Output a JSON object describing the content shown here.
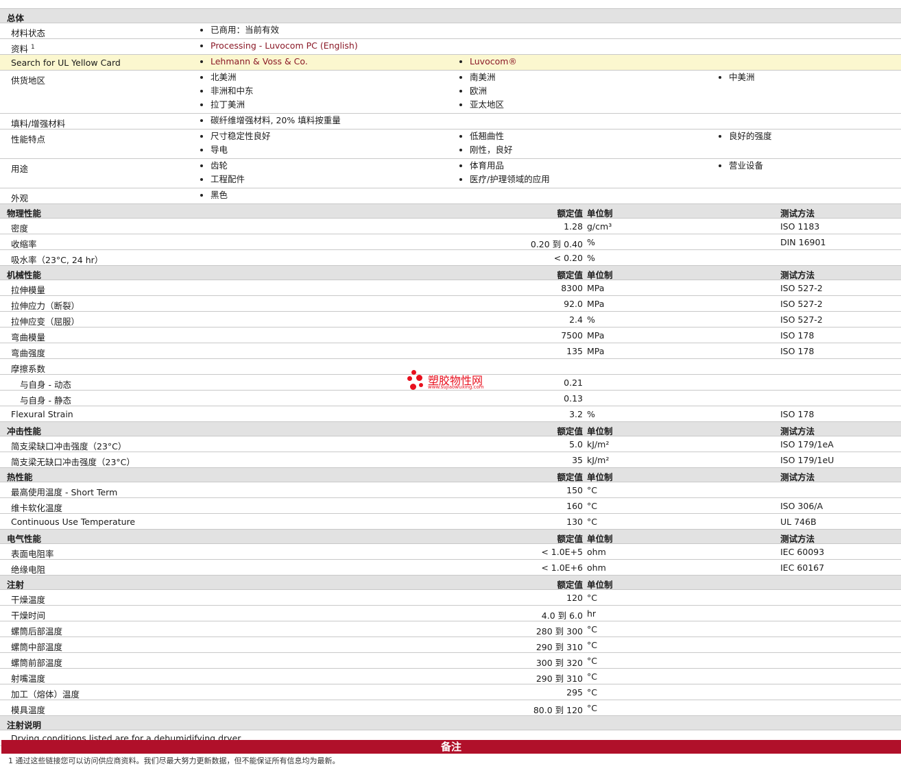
{
  "general": {
    "section_title": "总体",
    "rows": {
      "material_status": {
        "label": "材料状态",
        "value": "已商用：当前有效"
      },
      "literature": {
        "label": "资料",
        "footnote_mark": "1",
        "link": "Processing - Luvocom PC (English)"
      },
      "ul_card": {
        "label": "Search for UL Yellow Card",
        "link1": "Lehmann & Voss & Co.",
        "link2": "Luvocom®"
      },
      "supply_region": {
        "label": "供货地区",
        "col1": [
          "北美洲",
          "非洲和中东",
          "拉丁美洲"
        ],
        "col2": [
          "南美洲",
          "欧洲",
          "亚太地区"
        ],
        "col3": [
          "中美洲"
        ]
      },
      "filler": {
        "label": "填料/增强材料",
        "value": "碳纤维增强材料, 20% 填料按重量"
      },
      "features": {
        "label": "性能特点",
        "col1": [
          "尺寸稳定性良好",
          "导电"
        ],
        "col2": [
          "低翘曲性",
          "刚性，良好"
        ],
        "col3": [
          "良好的强度"
        ]
      },
      "uses": {
        "label": "用途",
        "col1": [
          "齿轮",
          "工程配件"
        ],
        "col2": [
          "体育用品",
          "医疗/护理领域的应用"
        ],
        "col3": [
          "营业设备"
        ]
      },
      "appearance": {
        "label": "外观",
        "value": "黑色"
      }
    }
  },
  "headers": {
    "value": "额定值",
    "unit": "单位制",
    "test": "测试方法"
  },
  "physical": {
    "title": "物理性能",
    "rows": [
      {
        "label": "密度",
        "value": "1.28",
        "unit": "g/cm³",
        "test": "ISO 1183"
      },
      {
        "label": "收缩率",
        "value": "0.20 到  0.40",
        "unit": "%",
        "test": "DIN 16901"
      },
      {
        "label": "吸水率（23°C, 24 hr）",
        "value": "< 0.20",
        "unit": "%",
        "test": ""
      }
    ]
  },
  "mechanical": {
    "title": "机械性能",
    "rows": [
      {
        "label": "拉伸模量",
        "value": "8300",
        "unit": "MPa",
        "test": "ISO 527-2"
      },
      {
        "label": "拉伸应力（断裂）",
        "value": "92.0",
        "unit": "MPa",
        "test": "ISO 527-2"
      },
      {
        "label": "拉伸应变（屈服）",
        "value": "2.4",
        "unit": "%",
        "test": "ISO 527-2"
      },
      {
        "label": "弯曲模量",
        "value": "7500",
        "unit": "MPa",
        "test": "ISO 178"
      },
      {
        "label": "弯曲强度",
        "value": "135",
        "unit": "MPa",
        "test": "ISO 178"
      },
      {
        "label": "摩擦系数",
        "value": "",
        "unit": "",
        "test": ""
      },
      {
        "label": "与自身  - 动态",
        "value": "0.21",
        "unit": "",
        "test": ""
      },
      {
        "label": "与自身  - 静态",
        "value": "0.13",
        "unit": "",
        "test": ""
      },
      {
        "label": "Flexural Strain",
        "value": "3.2",
        "unit": "%",
        "test": "ISO 178"
      }
    ]
  },
  "impact": {
    "title": "冲击性能",
    "rows": [
      {
        "label": "简支梁缺口冲击强度（23°C）",
        "value": "5.0",
        "unit": "kJ/m²",
        "test": "ISO 179/1eA"
      },
      {
        "label": "简支梁无缺口冲击强度（23°C）",
        "value": "35",
        "unit": "kJ/m²",
        "test": "ISO 179/1eU"
      }
    ]
  },
  "thermal": {
    "title": "热性能",
    "rows": [
      {
        "label": "最高使用温度  - Short Term",
        "value": "150",
        "unit": "°C",
        "test": ""
      },
      {
        "label": "维卡软化温度",
        "value": "160",
        "unit": "°C",
        "test": "ISO 306/A"
      },
      {
        "label": "Continuous Use Temperature",
        "value": "130",
        "unit": "°C",
        "test": "UL 746B"
      }
    ]
  },
  "electrical": {
    "title": "电气性能",
    "rows": [
      {
        "label": "表面电阻率",
        "value": "< 1.0E+5",
        "unit": "ohm",
        "test": "IEC 60093"
      },
      {
        "label": "绝缘电阻",
        "value": "< 1.0E+6",
        "unit": "ohm",
        "test": "IEC 60167"
      }
    ]
  },
  "injection": {
    "title": "注射",
    "rows": [
      {
        "label": "干燥温度",
        "value": "120",
        "unit": "°C"
      },
      {
        "label": "干燥时间",
        "value": "4.0 到  6.0",
        "unit": "hr"
      },
      {
        "label": "螺筒后部温度",
        "value": "280 到  300",
        "unit": "°C"
      },
      {
        "label": "螺筒中部温度",
        "value": "290 到  310",
        "unit": "°C"
      },
      {
        "label": "螺筒前部温度",
        "value": "300 到  320",
        "unit": "°C"
      },
      {
        "label": "射嘴温度",
        "value": "290 到  310",
        "unit": "°C"
      },
      {
        "label": "加工（熔体）温度",
        "value": "295",
        "unit": "°C"
      },
      {
        "label": "模具温度",
        "value": "80.0 到  120",
        "unit": "°C"
      }
    ]
  },
  "injection_notes": {
    "title": "注射说明",
    "text": "Drying conditions listed are for a dehumidifying dryer."
  },
  "remarks": {
    "title": "备注",
    "footnote": "1 通过这些链接您可以访问供应商资料。我们尽最大努力更新数据，但不能保证所有信息均为最新。"
  },
  "watermark": {
    "name": "塑胶物性网",
    "url": "www.sujiaowuxing.com",
    "color": "#e8101e"
  }
}
